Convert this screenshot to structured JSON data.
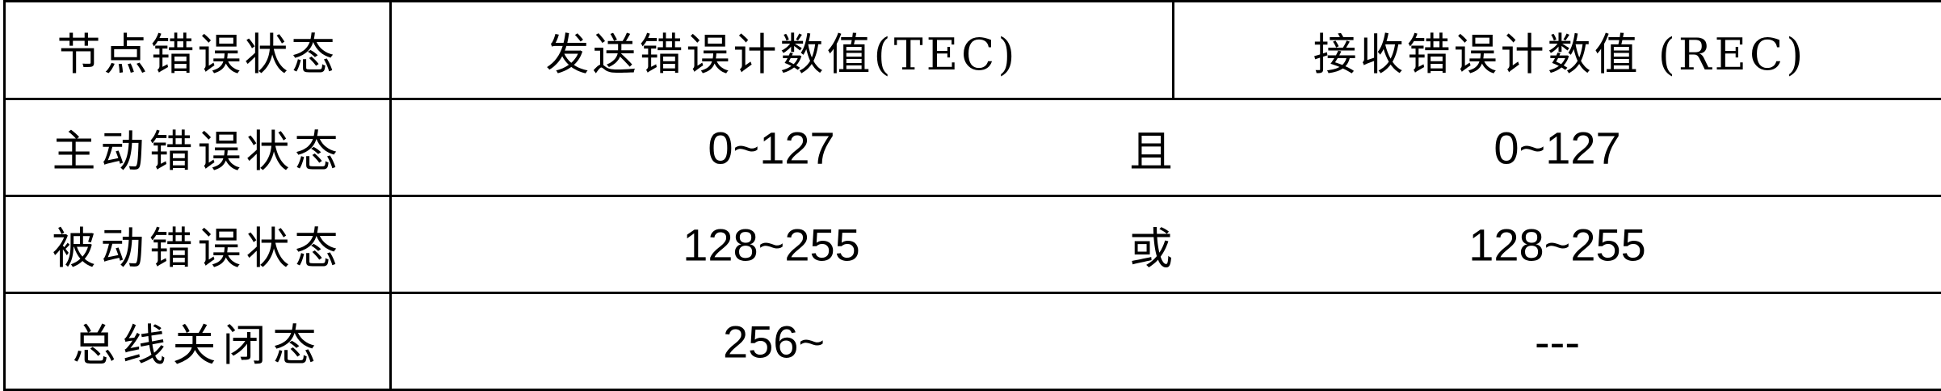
{
  "header": {
    "state_label": "节点错误状态",
    "tec_label": "发送错误计数值(TEC)",
    "rec_label": "接收错误计数值 (REC)"
  },
  "rows": [
    {
      "state": "主动错误状态",
      "tec": "0~127",
      "conj": "且",
      "rec": "0~127"
    },
    {
      "state": "被动错误状态",
      "tec": "128~255",
      "conj": "或",
      "rec": "128~255"
    },
    {
      "state": "总线关闭态",
      "tec": "256~",
      "conj": "",
      "rec": "---"
    }
  ]
}
